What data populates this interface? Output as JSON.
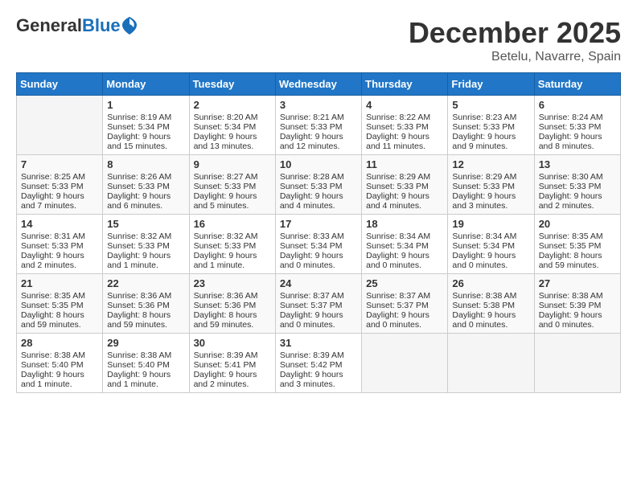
{
  "header": {
    "logo_general": "General",
    "logo_blue": "Blue",
    "month_title": "December 2025",
    "location": "Betelu, Navarre, Spain"
  },
  "weekdays": [
    "Sunday",
    "Monday",
    "Tuesday",
    "Wednesday",
    "Thursday",
    "Friday",
    "Saturday"
  ],
  "weeks": [
    [
      {
        "day": "",
        "sunrise": "",
        "sunset": "",
        "daylight": ""
      },
      {
        "day": "1",
        "sunrise": "Sunrise: 8:19 AM",
        "sunset": "Sunset: 5:34 PM",
        "daylight": "Daylight: 9 hours and 15 minutes."
      },
      {
        "day": "2",
        "sunrise": "Sunrise: 8:20 AM",
        "sunset": "Sunset: 5:34 PM",
        "daylight": "Daylight: 9 hours and 13 minutes."
      },
      {
        "day": "3",
        "sunrise": "Sunrise: 8:21 AM",
        "sunset": "Sunset: 5:33 PM",
        "daylight": "Daylight: 9 hours and 12 minutes."
      },
      {
        "day": "4",
        "sunrise": "Sunrise: 8:22 AM",
        "sunset": "Sunset: 5:33 PM",
        "daylight": "Daylight: 9 hours and 11 minutes."
      },
      {
        "day": "5",
        "sunrise": "Sunrise: 8:23 AM",
        "sunset": "Sunset: 5:33 PM",
        "daylight": "Daylight: 9 hours and 9 minutes."
      },
      {
        "day": "6",
        "sunrise": "Sunrise: 8:24 AM",
        "sunset": "Sunset: 5:33 PM",
        "daylight": "Daylight: 9 hours and 8 minutes."
      }
    ],
    [
      {
        "day": "7",
        "sunrise": "Sunrise: 8:25 AM",
        "sunset": "Sunset: 5:33 PM",
        "daylight": "Daylight: 9 hours and 7 minutes."
      },
      {
        "day": "8",
        "sunrise": "Sunrise: 8:26 AM",
        "sunset": "Sunset: 5:33 PM",
        "daylight": "Daylight: 9 hours and 6 minutes."
      },
      {
        "day": "9",
        "sunrise": "Sunrise: 8:27 AM",
        "sunset": "Sunset: 5:33 PM",
        "daylight": "Daylight: 9 hours and 5 minutes."
      },
      {
        "day": "10",
        "sunrise": "Sunrise: 8:28 AM",
        "sunset": "Sunset: 5:33 PM",
        "daylight": "Daylight: 9 hours and 4 minutes."
      },
      {
        "day": "11",
        "sunrise": "Sunrise: 8:29 AM",
        "sunset": "Sunset: 5:33 PM",
        "daylight": "Daylight: 9 hours and 4 minutes."
      },
      {
        "day": "12",
        "sunrise": "Sunrise: 8:29 AM",
        "sunset": "Sunset: 5:33 PM",
        "daylight": "Daylight: 9 hours and 3 minutes."
      },
      {
        "day": "13",
        "sunrise": "Sunrise: 8:30 AM",
        "sunset": "Sunset: 5:33 PM",
        "daylight": "Daylight: 9 hours and 2 minutes."
      }
    ],
    [
      {
        "day": "14",
        "sunrise": "Sunrise: 8:31 AM",
        "sunset": "Sunset: 5:33 PM",
        "daylight": "Daylight: 9 hours and 2 minutes."
      },
      {
        "day": "15",
        "sunrise": "Sunrise: 8:32 AM",
        "sunset": "Sunset: 5:33 PM",
        "daylight": "Daylight: 9 hours and 1 minute."
      },
      {
        "day": "16",
        "sunrise": "Sunrise: 8:32 AM",
        "sunset": "Sunset: 5:33 PM",
        "daylight": "Daylight: 9 hours and 1 minute."
      },
      {
        "day": "17",
        "sunrise": "Sunrise: 8:33 AM",
        "sunset": "Sunset: 5:34 PM",
        "daylight": "Daylight: 9 hours and 0 minutes."
      },
      {
        "day": "18",
        "sunrise": "Sunrise: 8:34 AM",
        "sunset": "Sunset: 5:34 PM",
        "daylight": "Daylight: 9 hours and 0 minutes."
      },
      {
        "day": "19",
        "sunrise": "Sunrise: 8:34 AM",
        "sunset": "Sunset: 5:34 PM",
        "daylight": "Daylight: 9 hours and 0 minutes."
      },
      {
        "day": "20",
        "sunrise": "Sunrise: 8:35 AM",
        "sunset": "Sunset: 5:35 PM",
        "daylight": "Daylight: 8 hours and 59 minutes."
      }
    ],
    [
      {
        "day": "21",
        "sunrise": "Sunrise: 8:35 AM",
        "sunset": "Sunset: 5:35 PM",
        "daylight": "Daylight: 8 hours and 59 minutes."
      },
      {
        "day": "22",
        "sunrise": "Sunrise: 8:36 AM",
        "sunset": "Sunset: 5:36 PM",
        "daylight": "Daylight: 8 hours and 59 minutes."
      },
      {
        "day": "23",
        "sunrise": "Sunrise: 8:36 AM",
        "sunset": "Sunset: 5:36 PM",
        "daylight": "Daylight: 8 hours and 59 minutes."
      },
      {
        "day": "24",
        "sunrise": "Sunrise: 8:37 AM",
        "sunset": "Sunset: 5:37 PM",
        "daylight": "Daylight: 9 hours and 0 minutes."
      },
      {
        "day": "25",
        "sunrise": "Sunrise: 8:37 AM",
        "sunset": "Sunset: 5:37 PM",
        "daylight": "Daylight: 9 hours and 0 minutes."
      },
      {
        "day": "26",
        "sunrise": "Sunrise: 8:38 AM",
        "sunset": "Sunset: 5:38 PM",
        "daylight": "Daylight: 9 hours and 0 minutes."
      },
      {
        "day": "27",
        "sunrise": "Sunrise: 8:38 AM",
        "sunset": "Sunset: 5:39 PM",
        "daylight": "Daylight: 9 hours and 0 minutes."
      }
    ],
    [
      {
        "day": "28",
        "sunrise": "Sunrise: 8:38 AM",
        "sunset": "Sunset: 5:40 PM",
        "daylight": "Daylight: 9 hours and 1 minute."
      },
      {
        "day": "29",
        "sunrise": "Sunrise: 8:38 AM",
        "sunset": "Sunset: 5:40 PM",
        "daylight": "Daylight: 9 hours and 1 minute."
      },
      {
        "day": "30",
        "sunrise": "Sunrise: 8:39 AM",
        "sunset": "Sunset: 5:41 PM",
        "daylight": "Daylight: 9 hours and 2 minutes."
      },
      {
        "day": "31",
        "sunrise": "Sunrise: 8:39 AM",
        "sunset": "Sunset: 5:42 PM",
        "daylight": "Daylight: 9 hours and 3 minutes."
      },
      {
        "day": "",
        "sunrise": "",
        "sunset": "",
        "daylight": ""
      },
      {
        "day": "",
        "sunrise": "",
        "sunset": "",
        "daylight": ""
      },
      {
        "day": "",
        "sunrise": "",
        "sunset": "",
        "daylight": ""
      }
    ]
  ]
}
